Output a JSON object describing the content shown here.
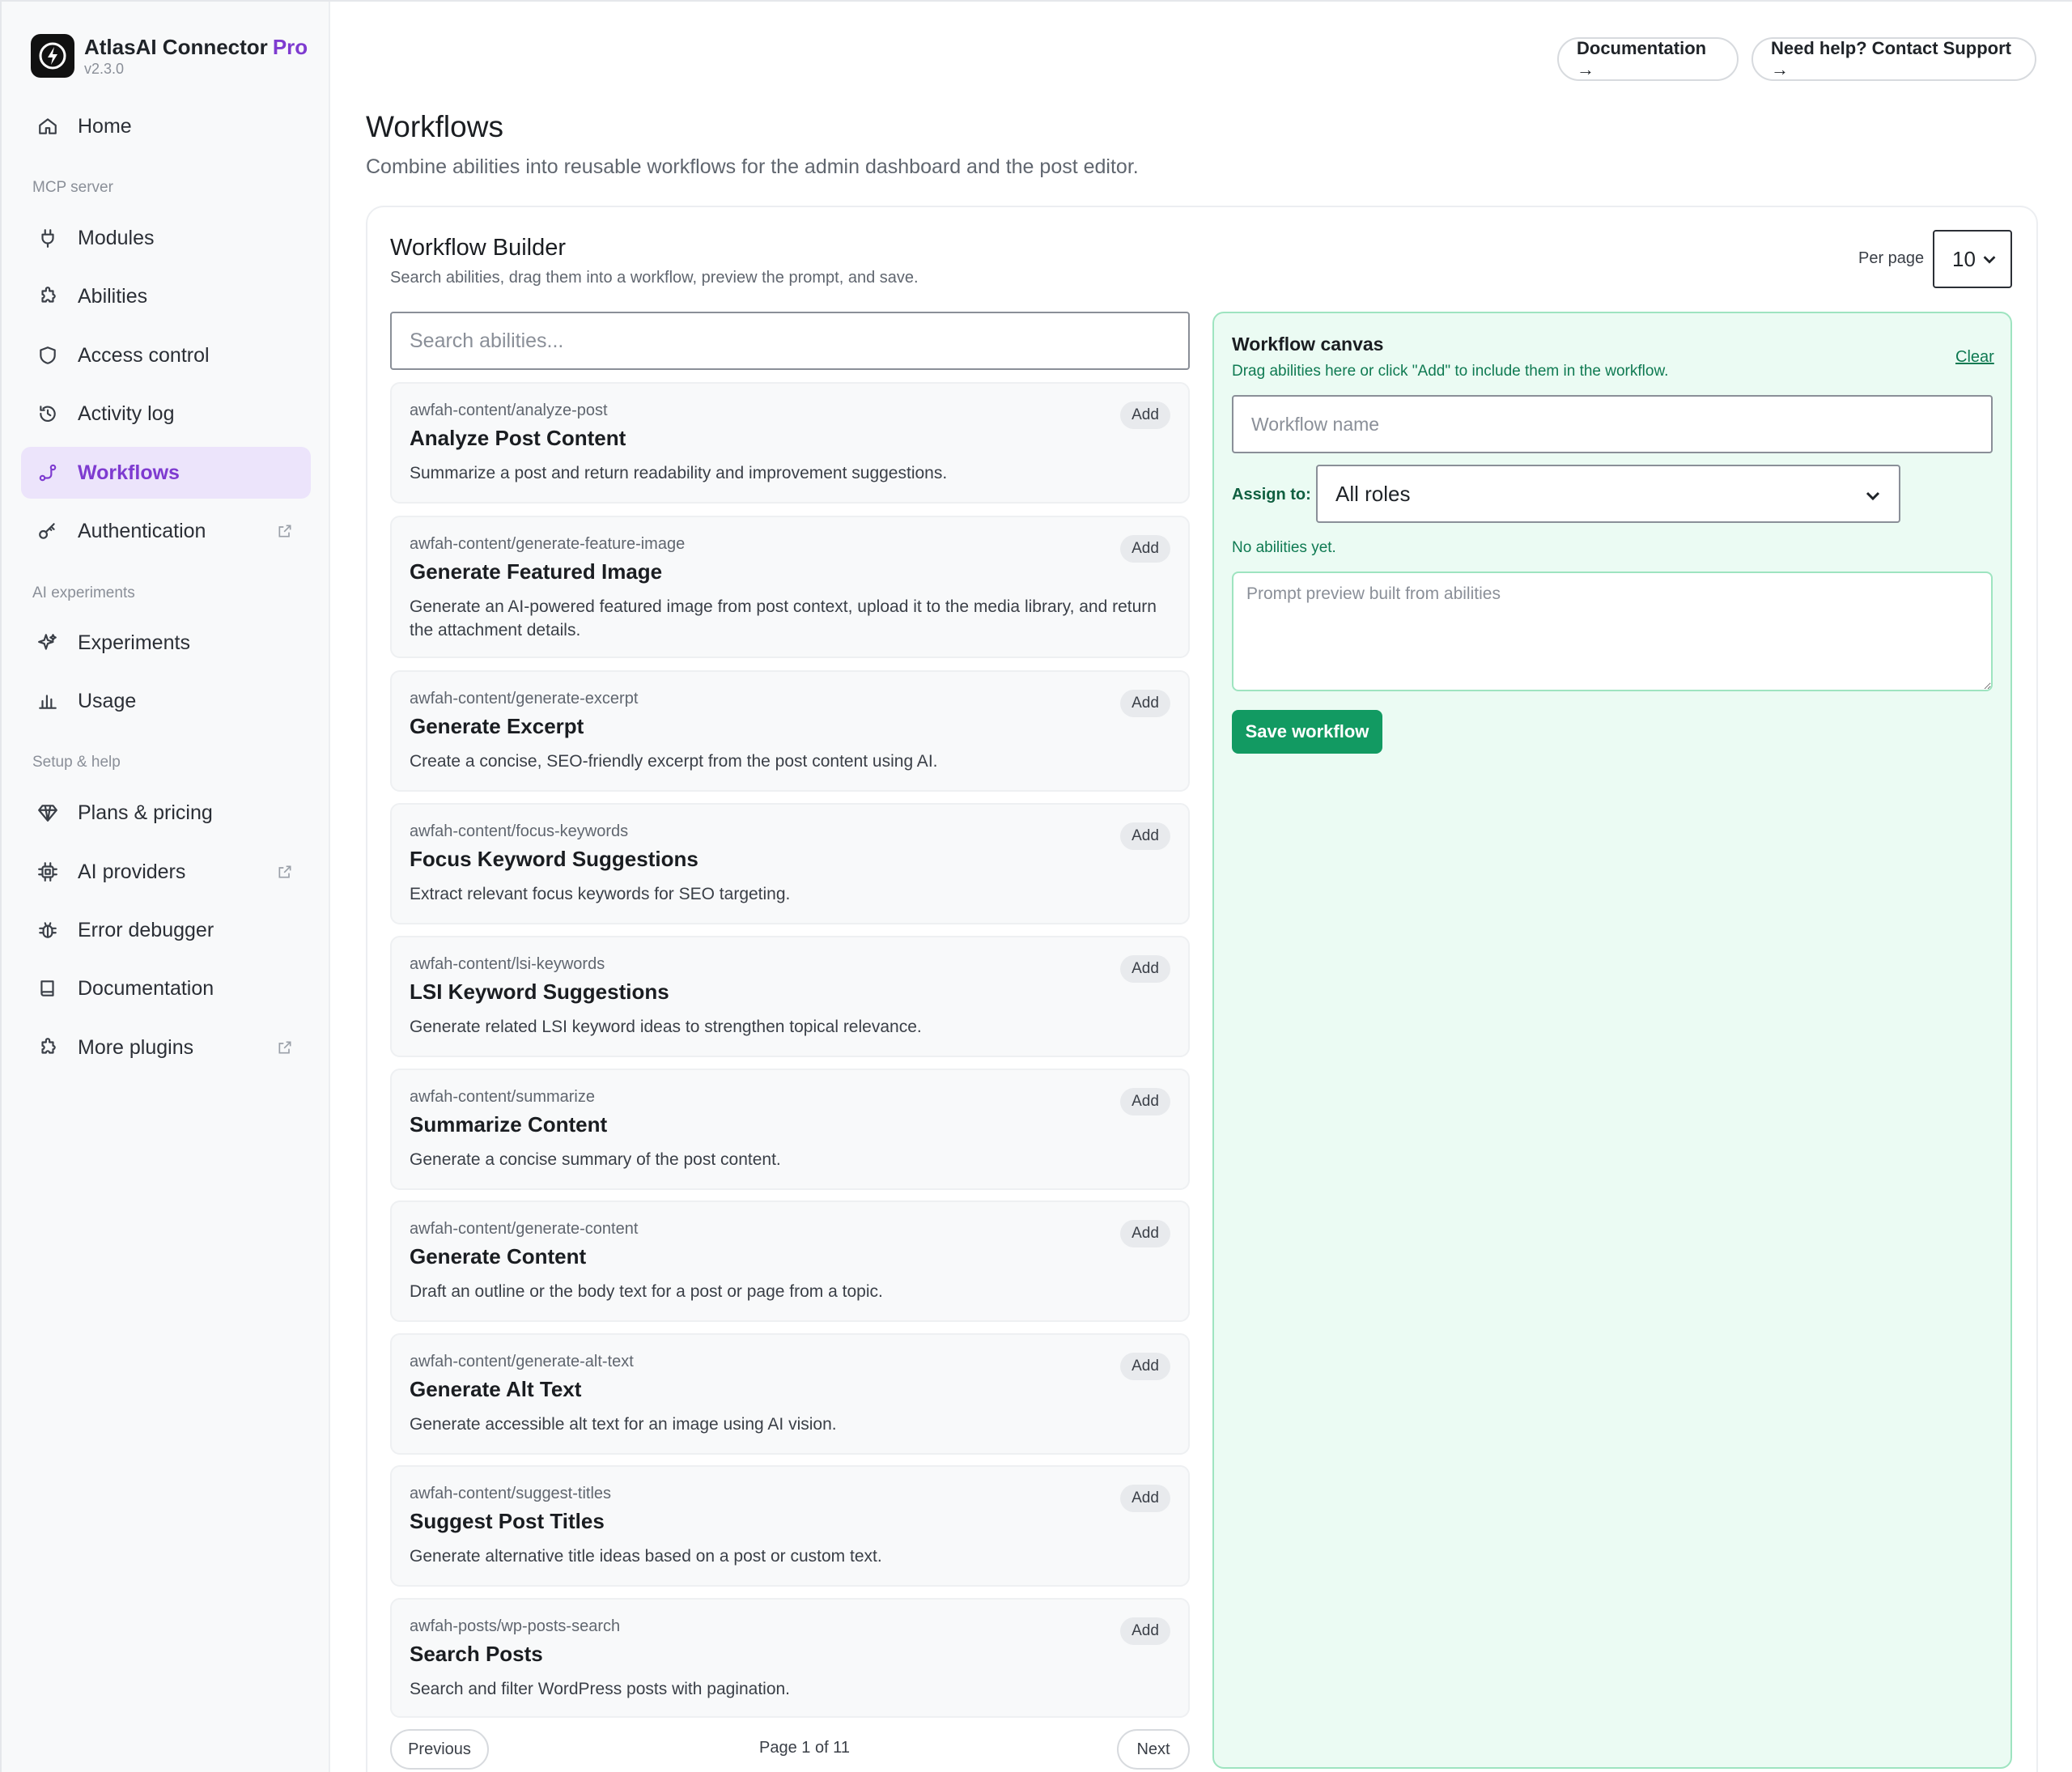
{
  "brand": {
    "name": "AtlasAI Connector",
    "tier": "Pro",
    "version": "v2.3.0"
  },
  "sidebar": {
    "home": "Home",
    "section_mcp": "MCP server",
    "modules": "Modules",
    "abilities": "Abilities",
    "access_control": "Access control",
    "activity_log": "Activity log",
    "workflows": "Workflows",
    "authentication": "Authentication",
    "section_ai": "AI experiments",
    "experiments": "Experiments",
    "usage": "Usage",
    "section_setup": "Setup & help",
    "plans": "Plans & pricing",
    "ai_providers": "AI providers",
    "error_debugger": "Error debugger",
    "documentation": "Documentation",
    "more_plugins": "More plugins",
    "active_item": "Workflows"
  },
  "header": {
    "documentation_btn": "Documentation →",
    "support_btn": "Need help? Contact Support →"
  },
  "page": {
    "title": "Workflows",
    "subtitle": "Combine abilities into reusable workflows for the admin dashboard and the post editor."
  },
  "builder": {
    "title": "Workflow Builder",
    "subtitle": "Search abilities, drag them into a workflow, preview the prompt, and save.",
    "per_page_label": "Per page",
    "per_page_value": "10",
    "search_placeholder": "Search abilities..."
  },
  "abilities": [
    {
      "slug": "awfah-content/analyze-post",
      "name": "Analyze Post Content",
      "desc": "Summarize a post and return readability and improvement suggestions.",
      "add": "Add"
    },
    {
      "slug": "awfah-content/generate-feature-image",
      "name": "Generate Featured Image",
      "desc": "Generate an AI-powered featured image from post context, upload it to the media library, and return the attachment details.",
      "add": "Add"
    },
    {
      "slug": "awfah-content/generate-excerpt",
      "name": "Generate Excerpt",
      "desc": "Create a concise, SEO-friendly excerpt from the post content using AI.",
      "add": "Add"
    },
    {
      "slug": "awfah-content/focus-keywords",
      "name": "Focus Keyword Suggestions",
      "desc": "Extract relevant focus keywords for SEO targeting.",
      "add": "Add"
    },
    {
      "slug": "awfah-content/lsi-keywords",
      "name": "LSI Keyword Suggestions",
      "desc": "Generate related LSI keyword ideas to strengthen topical relevance.",
      "add": "Add"
    },
    {
      "slug": "awfah-content/summarize",
      "name": "Summarize Content",
      "desc": "Generate a concise summary of the post content.",
      "add": "Add"
    },
    {
      "slug": "awfah-content/generate-content",
      "name": "Generate Content",
      "desc": "Draft an outline or the body text for a post or page from a topic.",
      "add": "Add"
    },
    {
      "slug": "awfah-content/generate-alt-text",
      "name": "Generate Alt Text",
      "desc": "Generate accessible alt text for an image using AI vision.",
      "add": "Add"
    },
    {
      "slug": "awfah-content/suggest-titles",
      "name": "Suggest Post Titles",
      "desc": "Generate alternative title ideas based on a post or custom text.",
      "add": "Add"
    },
    {
      "slug": "awfah-posts/wp-posts-search",
      "name": "Search Posts",
      "desc": "Search and filter WordPress posts with pagination.",
      "add": "Add"
    }
  ],
  "pagination": {
    "previous": "Previous",
    "info": "Page 1 of 11",
    "next": "Next"
  },
  "canvas": {
    "title": "Workflow canvas",
    "subtitle": "Drag abilities here or click \"Add\" to include them in the workflow.",
    "clear": "Clear",
    "name_placeholder": "Workflow name",
    "assign_label": "Assign to:",
    "assign_value": "All roles",
    "empty_state": "No abilities yet.",
    "prompt_placeholder": "Prompt preview built from abilities",
    "save_label": "Save workflow"
  },
  "colors": {
    "accent": "#7e3bd0",
    "success": "#129a62",
    "canvas_bg": "#ebfbf3"
  }
}
